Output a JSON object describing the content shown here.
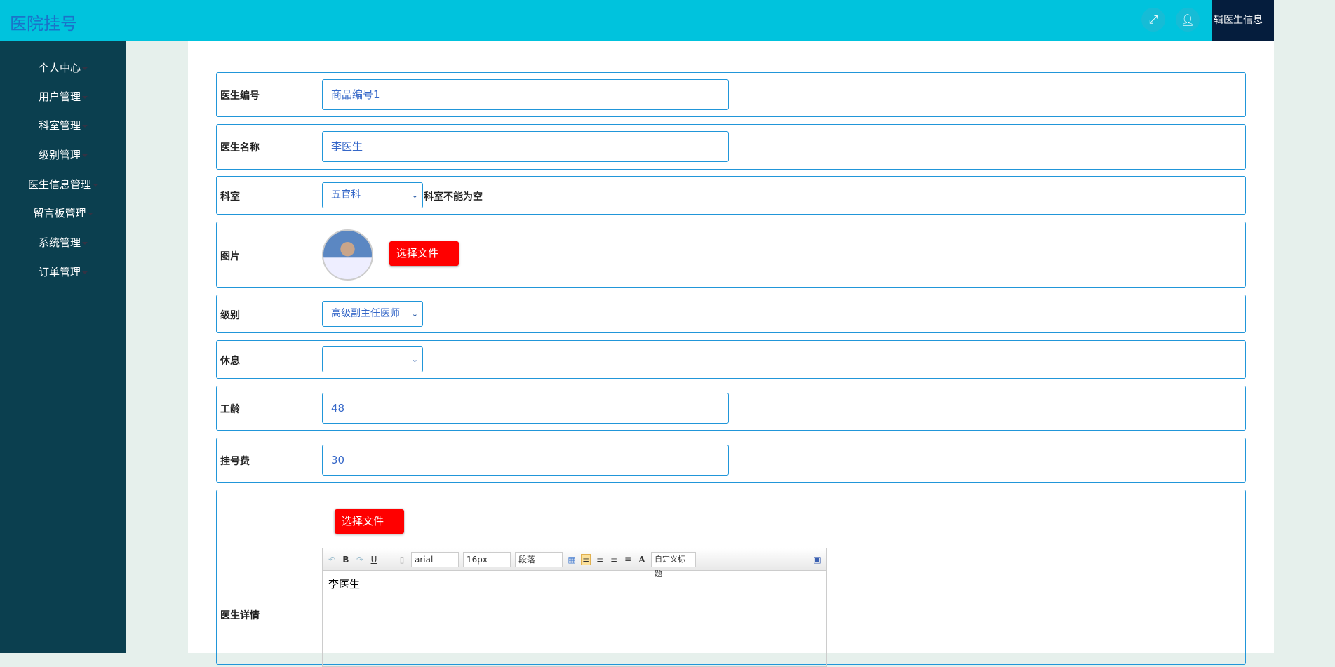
{
  "header": {
    "title": "医院挂号",
    "page_label": "辑医生信息"
  },
  "sidebar": {
    "items": [
      "个人中心",
      "用户管理",
      "科室管理",
      "级别管理",
      "医生信息管理",
      "留言板管理",
      "系统管理",
      "订单管理"
    ]
  },
  "form": {
    "doctor_id": {
      "label": "医生编号",
      "value": "商品编号1"
    },
    "doctor_name": {
      "label": "医生名称",
      "value": "李医生"
    },
    "department": {
      "label": "科室",
      "value": "五官科",
      "error": "科室不能为空"
    },
    "photo": {
      "label": "图片",
      "button": "选择文件"
    },
    "level": {
      "label": "级别",
      "value": "高级副主任医师"
    },
    "rest": {
      "label": "休息",
      "value": ""
    },
    "seniority": {
      "label": "工龄",
      "value": "48"
    },
    "fee": {
      "label": "挂号费",
      "value": "30"
    },
    "details": {
      "label": "医生详情",
      "button": "选择文件",
      "content": "李医生",
      "toolbar": {
        "font": "arial",
        "size": "16px",
        "paragraph": "段落",
        "custom": "自定义标题",
        "bold": "B",
        "underline": "U",
        "color": "A"
      }
    }
  }
}
